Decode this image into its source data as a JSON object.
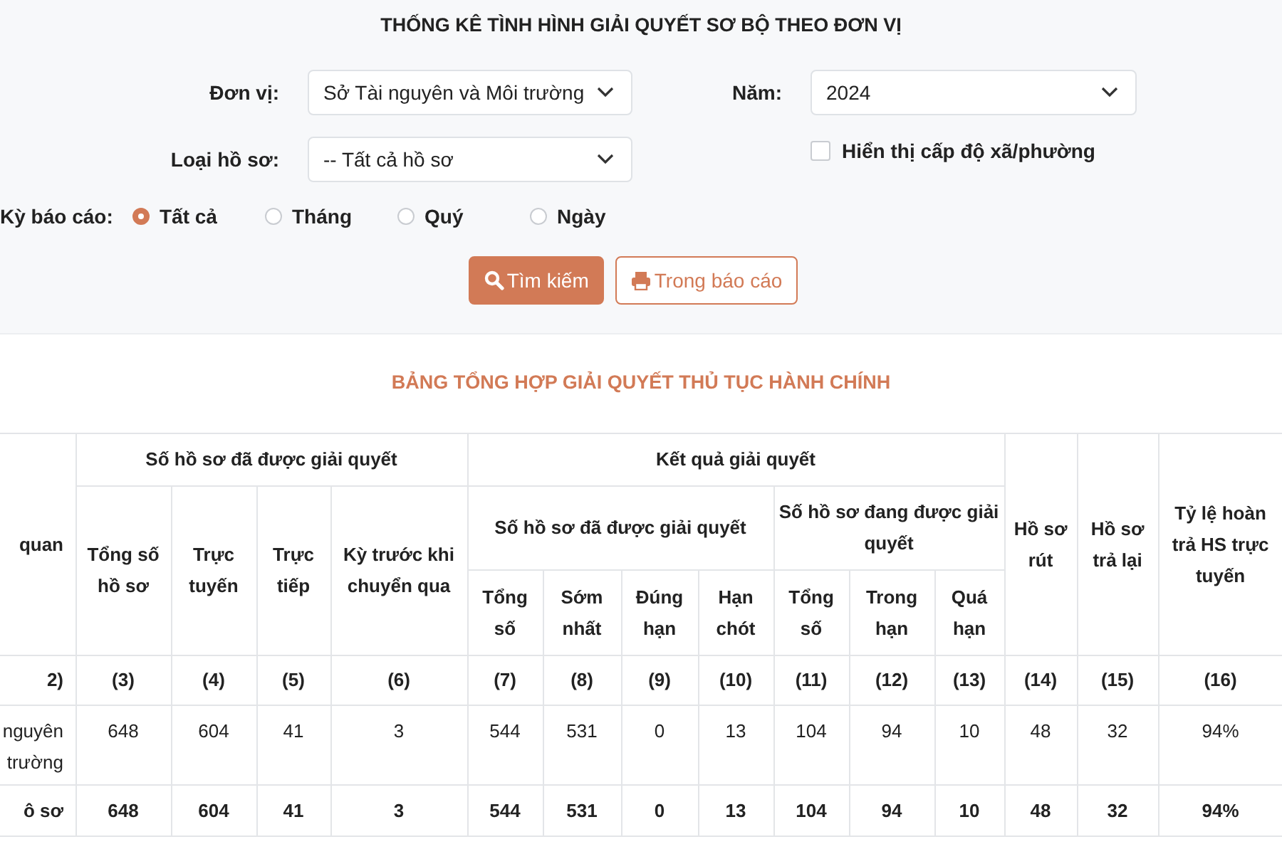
{
  "title": "THỐNG KÊ TÌNH HÌNH GIẢI QUYẾT SƠ BỘ THEO ĐƠN VỊ",
  "filters": {
    "unit": {
      "label": "Đơn vị:",
      "value": "Sở Tài nguyên và Môi trường"
    },
    "year": {
      "label": "Năm:",
      "value": "2024"
    },
    "record_type": {
      "label": "Loại hồ sơ:",
      "value": "-- Tất cả hồ sơ"
    },
    "show_ward_level": {
      "label": "Hiển thị cấp độ xã/phường",
      "checked": false
    },
    "report_period": {
      "label": "Kỳ báo cáo:",
      "options": [
        {
          "label": "Tất cả",
          "selected": true
        },
        {
          "label": "Tháng",
          "selected": false
        },
        {
          "label": "Quý",
          "selected": false
        },
        {
          "label": "Ngày",
          "selected": false
        }
      ]
    }
  },
  "buttons": [
    {
      "label": "Tìm kiếm",
      "kind": "primary"
    },
    {
      "label": "Trong báo cáo",
      "kind": "outline"
    }
  ],
  "table": {
    "title": "BẢNG TỔNG HỢP GIẢI QUYẾT THỦ TỤC HÀNH CHÍNH",
    "header_rows": [
      [
        {
          "text": "quan",
          "rowspan": 3
        },
        {
          "text": "Số hồ sơ đã được giải quyết",
          "colspan": 4
        },
        {
          "text": "Kết quả giải quyết",
          "colspan": 7
        },
        {
          "text": "Hồ sơ rút",
          "rowspan": 3
        },
        {
          "text": "Hồ sơ trả lại",
          "rowspan": 3
        },
        {
          "text": "Tỷ lệ hoàn trả HS trực tuyến",
          "rowspan": 3
        }
      ],
      [
        {
          "text": "Tổng số hồ sơ",
          "rowspan": 2
        },
        {
          "text": "Trực tuyến",
          "rowspan": 2
        },
        {
          "text": "Trực tiếp",
          "rowspan": 2
        },
        {
          "text": "Kỳ trước khi chuyển qua",
          "rowspan": 2
        },
        {
          "text": "Số hồ sơ đã được giải quyết",
          "colspan": 4
        },
        {
          "text": "Số hồ sơ đang được giải quyết",
          "colspan": 3
        }
      ],
      [
        {
          "text": "Tổng số"
        },
        {
          "text": "Sớm nhất"
        },
        {
          "text": "Đúng hạn"
        },
        {
          "text": "Hạn chót"
        },
        {
          "text": "Tổng số"
        },
        {
          "text": "Trong hạn"
        },
        {
          "text": "Quá hạn"
        }
      ]
    ],
    "index_row": [
      "2)",
      "(3)",
      "(4)",
      "(5)",
      "(6)",
      "(7)",
      "(8)",
      "(9)",
      "(10)",
      "(11)",
      "(12)",
      "(13)",
      "(14)",
      "(15)",
      "(16)"
    ],
    "rows": [
      {
        "kind": "data",
        "cells": [
          "nguyên trường",
          "648",
          "604",
          "41",
          "3",
          "544",
          "531",
          "0",
          "13",
          "104",
          "94",
          "10",
          "48",
          "32",
          "94%"
        ]
      },
      {
        "kind": "total",
        "cells": [
          "ô sơ",
          "648",
          "604",
          "41",
          "3",
          "544",
          "531",
          "0",
          "13",
          "104",
          "94",
          "10",
          "48",
          "32",
          "94%"
        ]
      }
    ]
  }
}
